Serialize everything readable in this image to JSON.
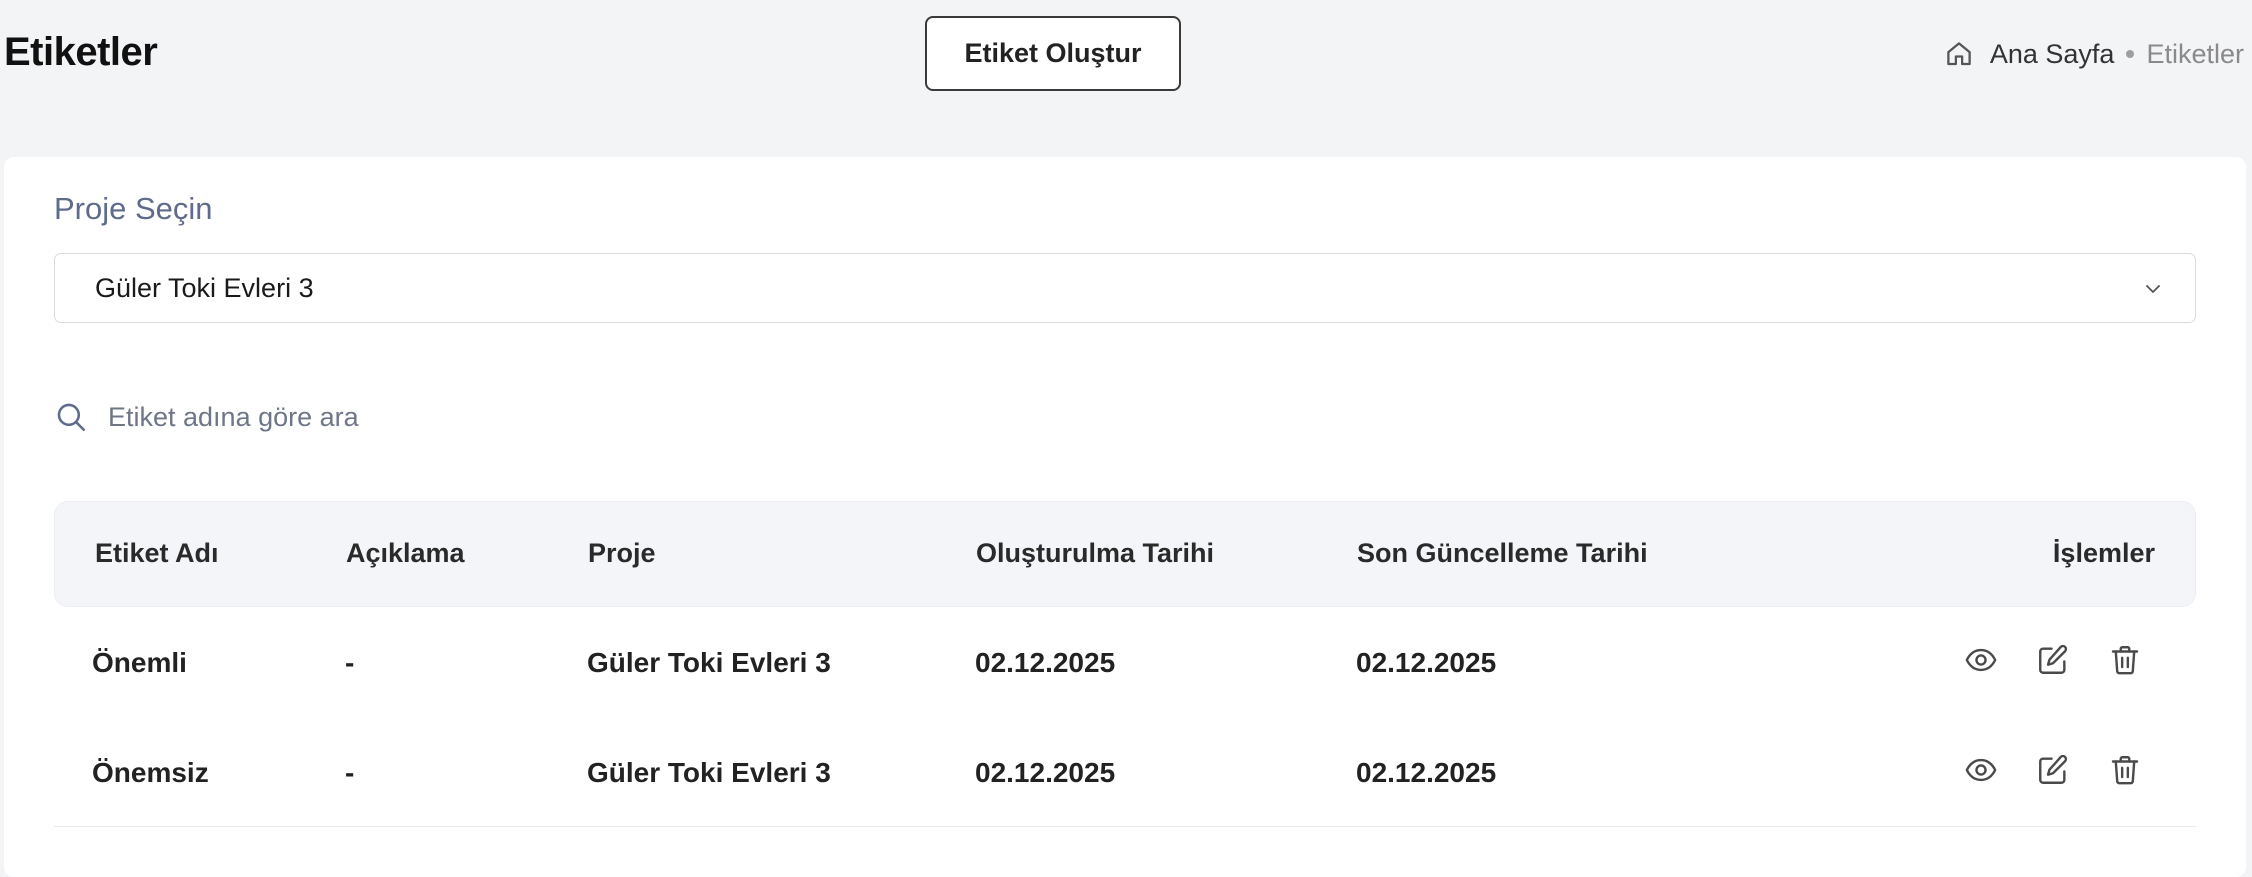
{
  "header": {
    "title": "Etiketler",
    "create_button": "Etiket Oluştur",
    "breadcrumb": {
      "home": "Ana Sayfa",
      "current": "Etiketler"
    }
  },
  "project_select": {
    "label": "Proje Seçin",
    "value": "Güler Toki Evleri 3"
  },
  "search": {
    "placeholder": "Etiket adına göre ara",
    "value": ""
  },
  "table": {
    "columns": [
      "Etiket Adı",
      "Açıklama",
      "Proje",
      "Oluşturulma Tarihi",
      "Son Güncelleme Tarihi",
      "İşlemler"
    ],
    "rows": [
      {
        "name": "Önemli",
        "description": "-",
        "project": "Güler Toki Evleri 3",
        "created": "02.12.2025",
        "updated": "02.12.2025"
      },
      {
        "name": "Önemsiz",
        "description": "-",
        "project": "Güler Toki Evleri 3",
        "created": "02.12.2025",
        "updated": "02.12.2025"
      }
    ],
    "row_actions": [
      "eye-icon",
      "edit-icon",
      "trash-icon"
    ]
  },
  "colors": {
    "background": "#f3f4f6",
    "card": "#ffffff",
    "label": "#5f6b8a",
    "table_header_bg": "#f4f5f8"
  }
}
